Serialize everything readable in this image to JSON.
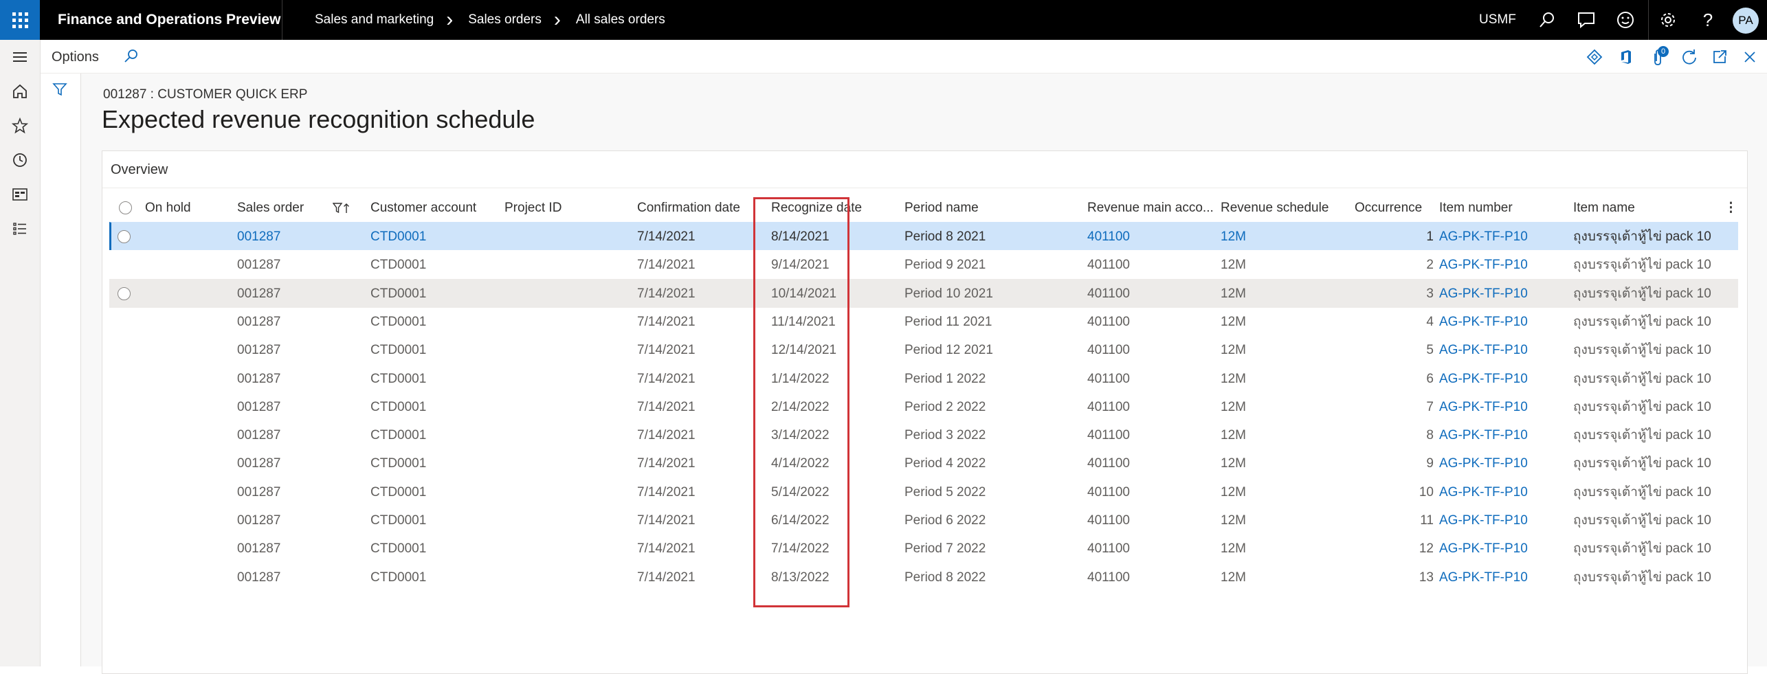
{
  "topbar": {
    "app_name": "Finance and Operations Preview",
    "breadcrumb": [
      "Sales and marketing",
      "Sales orders",
      "All sales orders"
    ],
    "company": "USMF",
    "avatar": "PA",
    "help": "?"
  },
  "actionpane": {
    "options_label": "Options",
    "badge_count": "0"
  },
  "page": {
    "caption": "001287 : CUSTOMER QUICK ERP",
    "title": "Expected revenue recognition schedule",
    "section": "Overview"
  },
  "grid": {
    "columns": [
      "On hold",
      "Sales order",
      "Customer account",
      "Project ID",
      "Confirmation date",
      "Recognize date",
      "Period name",
      "Revenue main acco...",
      "Revenue schedule",
      "Occurrence",
      "Item number",
      "Item name"
    ],
    "rows": [
      {
        "sales_order": "001287",
        "customer": "CTD0001",
        "project": "",
        "confirmation": "7/14/2021",
        "recognize": "8/14/2021",
        "period": "Period 8 2021",
        "account": "401100",
        "schedule": "12M",
        "occurrence": "1",
        "item_number": "AG-PK-TF-P10",
        "item_name": "ถุงบรรจุเต้าหู้ไข่ pack 10"
      },
      {
        "sales_order": "001287",
        "customer": "CTD0001",
        "project": "",
        "confirmation": "7/14/2021",
        "recognize": "9/14/2021",
        "period": "Period 9 2021",
        "account": "401100",
        "schedule": "12M",
        "occurrence": "2",
        "item_number": "AG-PK-TF-P10",
        "item_name": "ถุงบรรจุเต้าหู้ไข่ pack 10"
      },
      {
        "sales_order": "001287",
        "customer": "CTD0001",
        "project": "",
        "confirmation": "7/14/2021",
        "recognize": "10/14/2021",
        "period": "Period 10 2021",
        "account": "401100",
        "schedule": "12M",
        "occurrence": "3",
        "item_number": "AG-PK-TF-P10",
        "item_name": "ถุงบรรจุเต้าหู้ไข่ pack 10"
      },
      {
        "sales_order": "001287",
        "customer": "CTD0001",
        "project": "",
        "confirmation": "7/14/2021",
        "recognize": "11/14/2021",
        "period": "Period 11 2021",
        "account": "401100",
        "schedule": "12M",
        "occurrence": "4",
        "item_number": "AG-PK-TF-P10",
        "item_name": "ถุงบรรจุเต้าหู้ไข่ pack 10"
      },
      {
        "sales_order": "001287",
        "customer": "CTD0001",
        "project": "",
        "confirmation": "7/14/2021",
        "recognize": "12/14/2021",
        "period": "Period 12 2021",
        "account": "401100",
        "schedule": "12M",
        "occurrence": "5",
        "item_number": "AG-PK-TF-P10",
        "item_name": "ถุงบรรจุเต้าหู้ไข่ pack 10"
      },
      {
        "sales_order": "001287",
        "customer": "CTD0001",
        "project": "",
        "confirmation": "7/14/2021",
        "recognize": "1/14/2022",
        "period": "Period 1 2022",
        "account": "401100",
        "schedule": "12M",
        "occurrence": "6",
        "item_number": "AG-PK-TF-P10",
        "item_name": "ถุงบรรจุเต้าหู้ไข่ pack 10"
      },
      {
        "sales_order": "001287",
        "customer": "CTD0001",
        "project": "",
        "confirmation": "7/14/2021",
        "recognize": "2/14/2022",
        "period": "Period 2 2022",
        "account": "401100",
        "schedule": "12M",
        "occurrence": "7",
        "item_number": "AG-PK-TF-P10",
        "item_name": "ถุงบรรจุเต้าหู้ไข่ pack 10"
      },
      {
        "sales_order": "001287",
        "customer": "CTD0001",
        "project": "",
        "confirmation": "7/14/2021",
        "recognize": "3/14/2022",
        "period": "Period 3 2022",
        "account": "401100",
        "schedule": "12M",
        "occurrence": "8",
        "item_number": "AG-PK-TF-P10",
        "item_name": "ถุงบรรจุเต้าหู้ไข่ pack 10"
      },
      {
        "sales_order": "001287",
        "customer": "CTD0001",
        "project": "",
        "confirmation": "7/14/2021",
        "recognize": "4/14/2022",
        "period": "Period 4 2022",
        "account": "401100",
        "schedule": "12M",
        "occurrence": "9",
        "item_number": "AG-PK-TF-P10",
        "item_name": "ถุงบรรจุเต้าหู้ไข่ pack 10"
      },
      {
        "sales_order": "001287",
        "customer": "CTD0001",
        "project": "",
        "confirmation": "7/14/2021",
        "recognize": "5/14/2022",
        "period": "Period 5 2022",
        "account": "401100",
        "schedule": "12M",
        "occurrence": "10",
        "item_number": "AG-PK-TF-P10",
        "item_name": "ถุงบรรจุเต้าหู้ไข่ pack 10"
      },
      {
        "sales_order": "001287",
        "customer": "CTD0001",
        "project": "",
        "confirmation": "7/14/2021",
        "recognize": "6/14/2022",
        "period": "Period 6 2022",
        "account": "401100",
        "schedule": "12M",
        "occurrence": "11",
        "item_number": "AG-PK-TF-P10",
        "item_name": "ถุงบรรจุเต้าหู้ไข่ pack 10"
      },
      {
        "sales_order": "001287",
        "customer": "CTD0001",
        "project": "",
        "confirmation": "7/14/2021",
        "recognize": "7/14/2022",
        "period": "Period 7 2022",
        "account": "401100",
        "schedule": "12M",
        "occurrence": "12",
        "item_number": "AG-PK-TF-P10",
        "item_name": "ถุงบรรจุเต้าหู้ไข่ pack 10"
      },
      {
        "sales_order": "001287",
        "customer": "CTD0001",
        "project": "",
        "confirmation": "7/14/2021",
        "recognize": "8/13/2022",
        "period": "Period 8 2022",
        "account": "401100",
        "schedule": "12M",
        "occurrence": "13",
        "item_number": "AG-PK-TF-P10",
        "item_name": "ถุงบรรจุเต้าหู้ไข่ pack 10"
      }
    ]
  },
  "colors": {
    "accent": "#0f6cbd",
    "selected_row": "#cfe4fa",
    "highlight_border": "#d13438"
  },
  "icons": [
    "waffle-icon",
    "search-icon",
    "chat-icon",
    "smiley-icon",
    "gear-icon",
    "help-icon",
    "hamburger-icon",
    "home-icon",
    "star-icon",
    "clock-icon",
    "workspace-icon",
    "list-icon",
    "filter-icon",
    "diamond-icon",
    "office-icon",
    "attachment-icon",
    "refresh-icon",
    "open-new-icon",
    "close-icon",
    "column-filter-icon",
    "more-icon"
  ]
}
